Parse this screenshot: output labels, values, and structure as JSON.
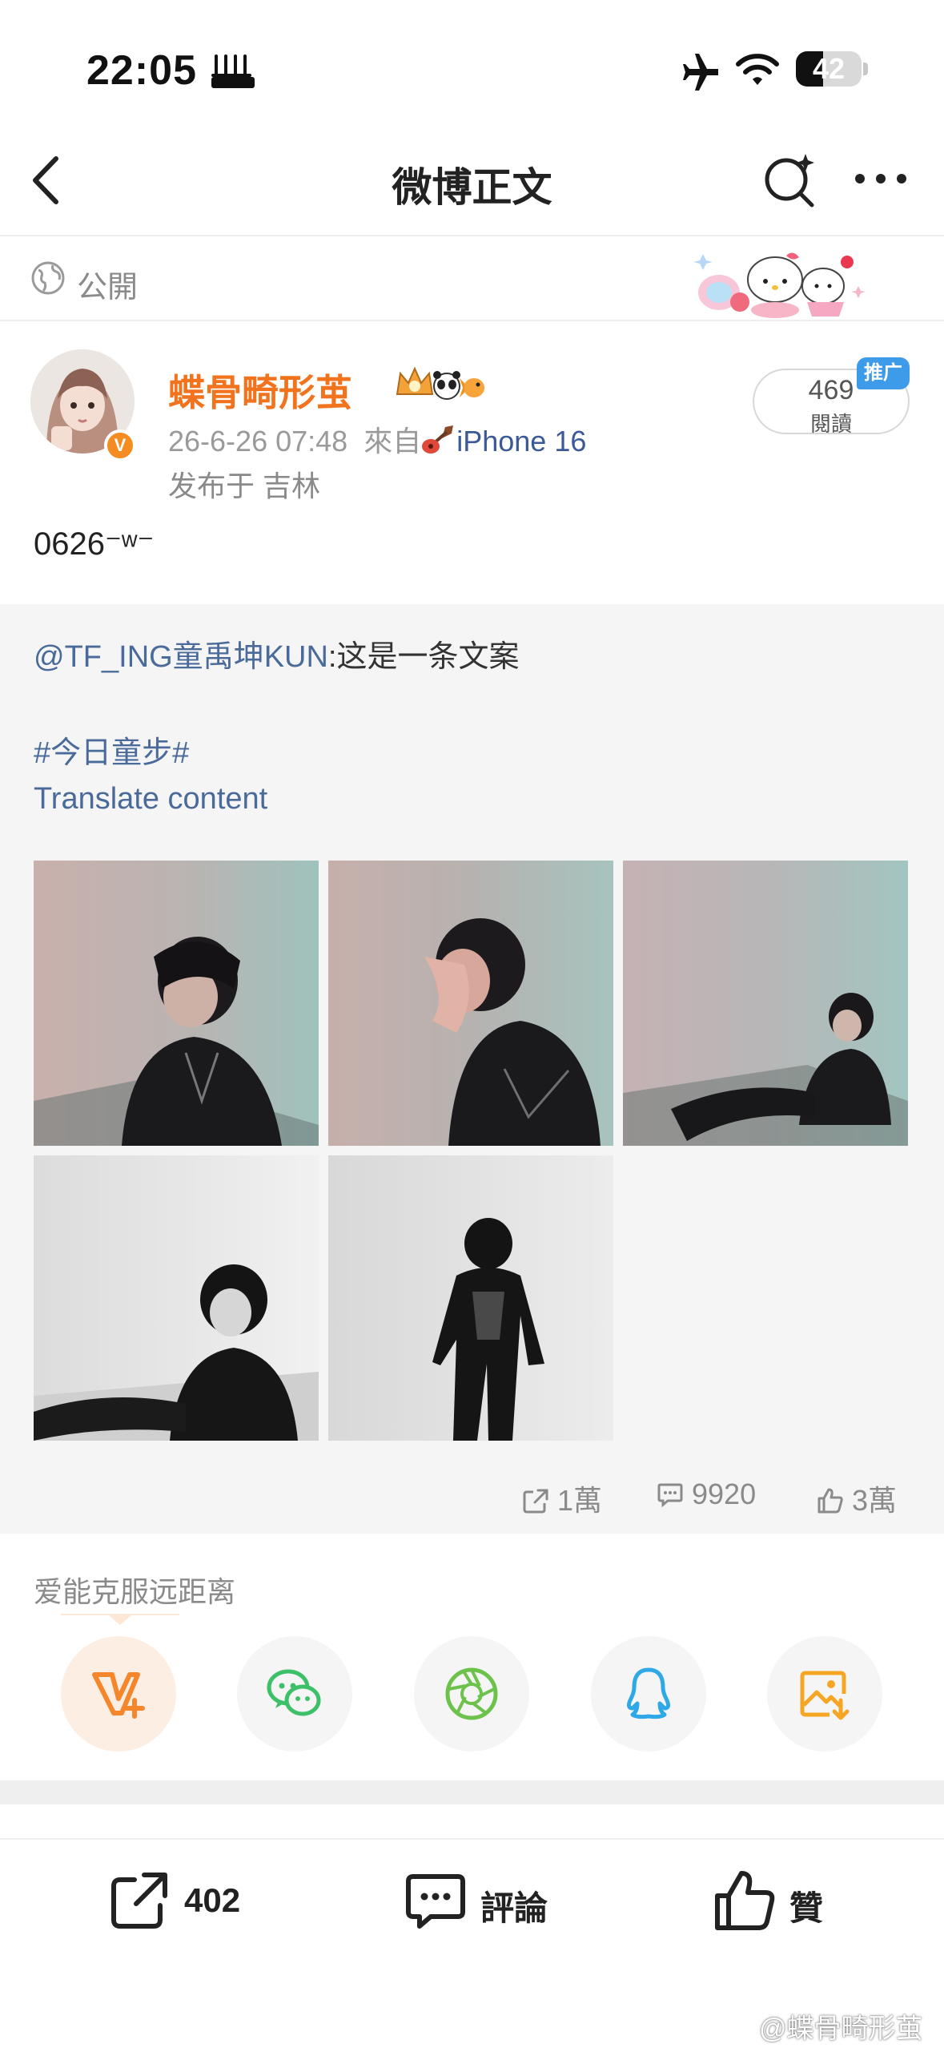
{
  "status_bar": {
    "time": "22:05",
    "battery": "42",
    "battery_level": 0.42
  },
  "nav": {
    "title": "微博正文"
  },
  "visibility": {
    "label": "公開"
  },
  "post": {
    "author": "蝶骨畸形茧",
    "avatar_badge": "V",
    "date": "26-6-26 07:48",
    "source_prefix": "來自",
    "device": "iPhone 16",
    "location": "发布于 吉林",
    "reads_count": "469",
    "reads_label": "閱讀",
    "promo_tag": "推广",
    "text": "0626⁻ʷ⁻"
  },
  "repost": {
    "mention": "@TF_ING童禹坤KUN",
    "body": ":这是一条文案",
    "hashtag": "#今日童步#",
    "translate": "Translate content",
    "photos": [
      {
        "name": "photo-1",
        "tone": "color",
        "caption": ""
      },
      {
        "name": "photo-2",
        "tone": "color",
        "caption": ""
      },
      {
        "name": "photo-3",
        "tone": "color",
        "caption": ""
      },
      {
        "name": "photo-4",
        "tone": "gray",
        "caption": ""
      },
      {
        "name": "photo-5",
        "tone": "gray",
        "caption": ""
      }
    ],
    "stats": {
      "reposts": "1萬",
      "comments": "9920",
      "likes": "3萬"
    }
  },
  "share": {
    "title": "爱能克服远距离",
    "targets": [
      {
        "name": "share-vplus",
        "icon": "vplus-icon",
        "color": "#f5862b"
      },
      {
        "name": "share-wechat",
        "icon": "wechat-icon",
        "color": "#3ec06a"
      },
      {
        "name": "share-moments",
        "icon": "moments-icon",
        "color": "#6cc24a"
      },
      {
        "name": "share-qq",
        "icon": "qq-icon",
        "color": "#2ea8e6"
      },
      {
        "name": "share-save-image",
        "icon": "save-image-icon",
        "color": "#f5a623"
      }
    ]
  },
  "action_bar": {
    "repost": "402",
    "comment": "評論",
    "like": "贊"
  },
  "watermark": "@蝶骨畸形茧",
  "colors": {
    "author": "#f2731d",
    "link": "#4a6a9a",
    "badge": "#f58c22",
    "promo": "#3d9be9"
  }
}
